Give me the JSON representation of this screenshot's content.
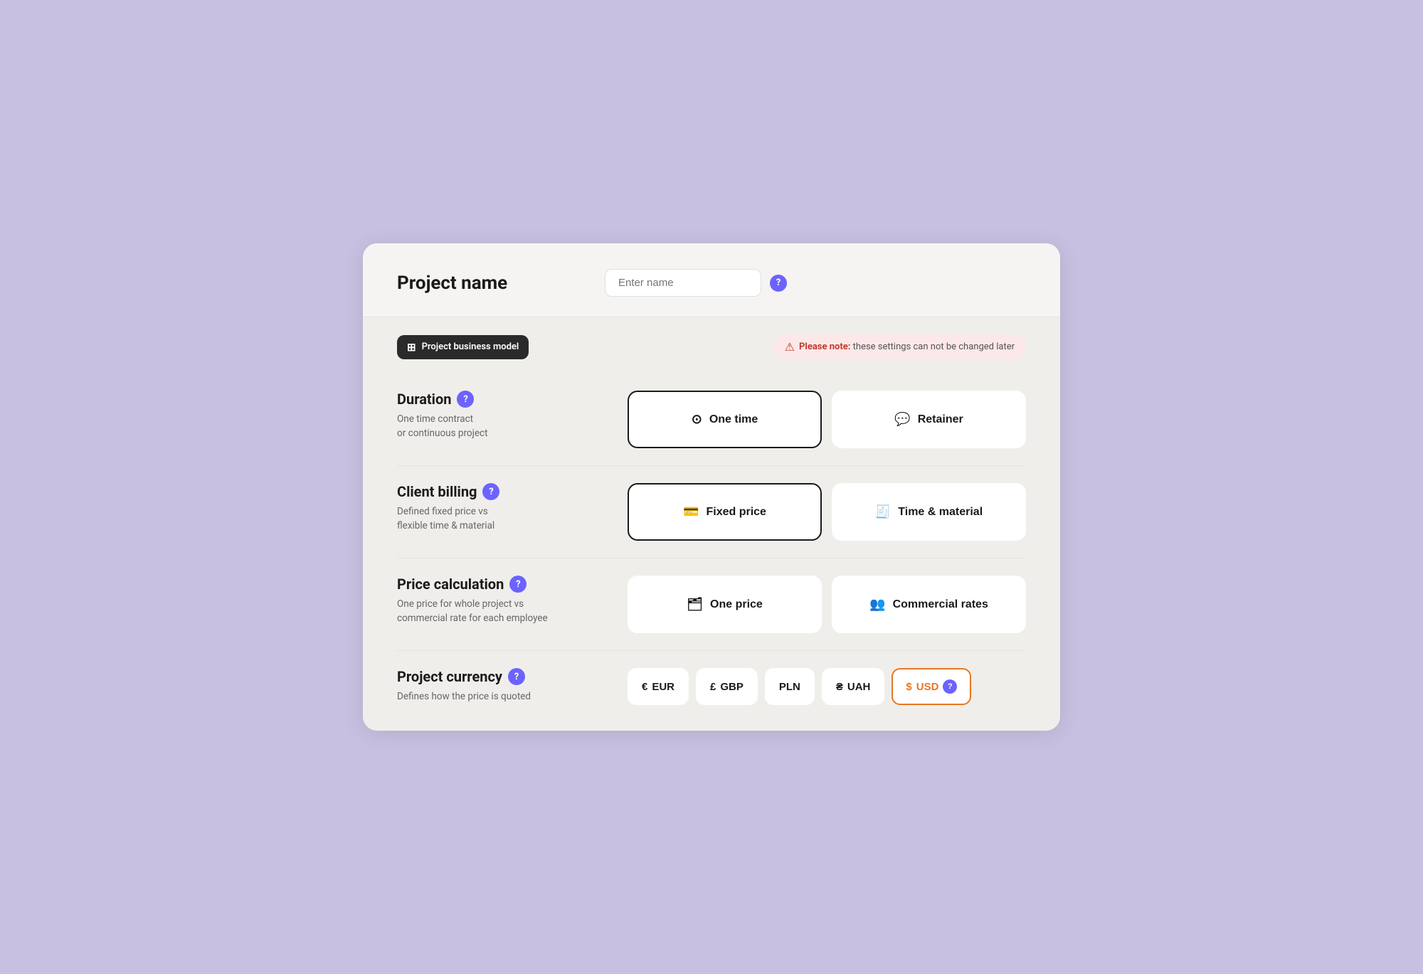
{
  "page": {
    "background_color": "#c8c0e0",
    "card_background": "#f5f4f2"
  },
  "project_name": {
    "label": "Project name",
    "input_placeholder": "Enter name",
    "help_icon": "?"
  },
  "business_model": {
    "badge_icon": "⊞",
    "badge_label": "Project business model",
    "warning_strong": "Please note:",
    "warning_text": " these settings can not be changed later"
  },
  "duration": {
    "title": "Duration",
    "help_icon": "?",
    "description_line1": "One time contract",
    "description_line2": "or continuous project",
    "options": [
      {
        "id": "one-time",
        "icon": "⊙",
        "label": "One time",
        "selected": true
      },
      {
        "id": "retainer",
        "icon": "💬",
        "label": "Retainer",
        "selected": false
      }
    ]
  },
  "client_billing": {
    "title": "Client billing",
    "help_icon": "?",
    "description_line1": "Defined fixed price vs",
    "description_line2": "flexible time & material",
    "options": [
      {
        "id": "fixed-price",
        "icon": "💳",
        "label": "Fixed price",
        "selected": true
      },
      {
        "id": "time-material",
        "icon": "🧾",
        "label": "Time & material",
        "selected": false
      }
    ]
  },
  "price_calculation": {
    "title": "Price calculation",
    "help_icon": "?",
    "description_line1": "One price for whole project vs",
    "description_line2": "commercial rate for each employee",
    "options": [
      {
        "id": "one-price",
        "icon": "🗂",
        "label": "One price",
        "selected": false
      },
      {
        "id": "commercial-rates",
        "icon": "👥",
        "label": "Commercial rates",
        "selected": false
      }
    ]
  },
  "project_currency": {
    "title": "Project currency",
    "help_icon": "?",
    "description": "Defines how the price is quoted",
    "options": [
      {
        "id": "eur",
        "symbol": "€",
        "label": "EUR",
        "selected": false
      },
      {
        "id": "gbp",
        "symbol": "£",
        "label": "GBP",
        "selected": false
      },
      {
        "id": "pln",
        "symbol": "",
        "label": "PLN",
        "selected": false
      },
      {
        "id": "uah",
        "symbol": "₴",
        "label": "UAH",
        "selected": false
      },
      {
        "id": "usd",
        "symbol": "$",
        "label": "USD",
        "selected": true
      }
    ]
  }
}
